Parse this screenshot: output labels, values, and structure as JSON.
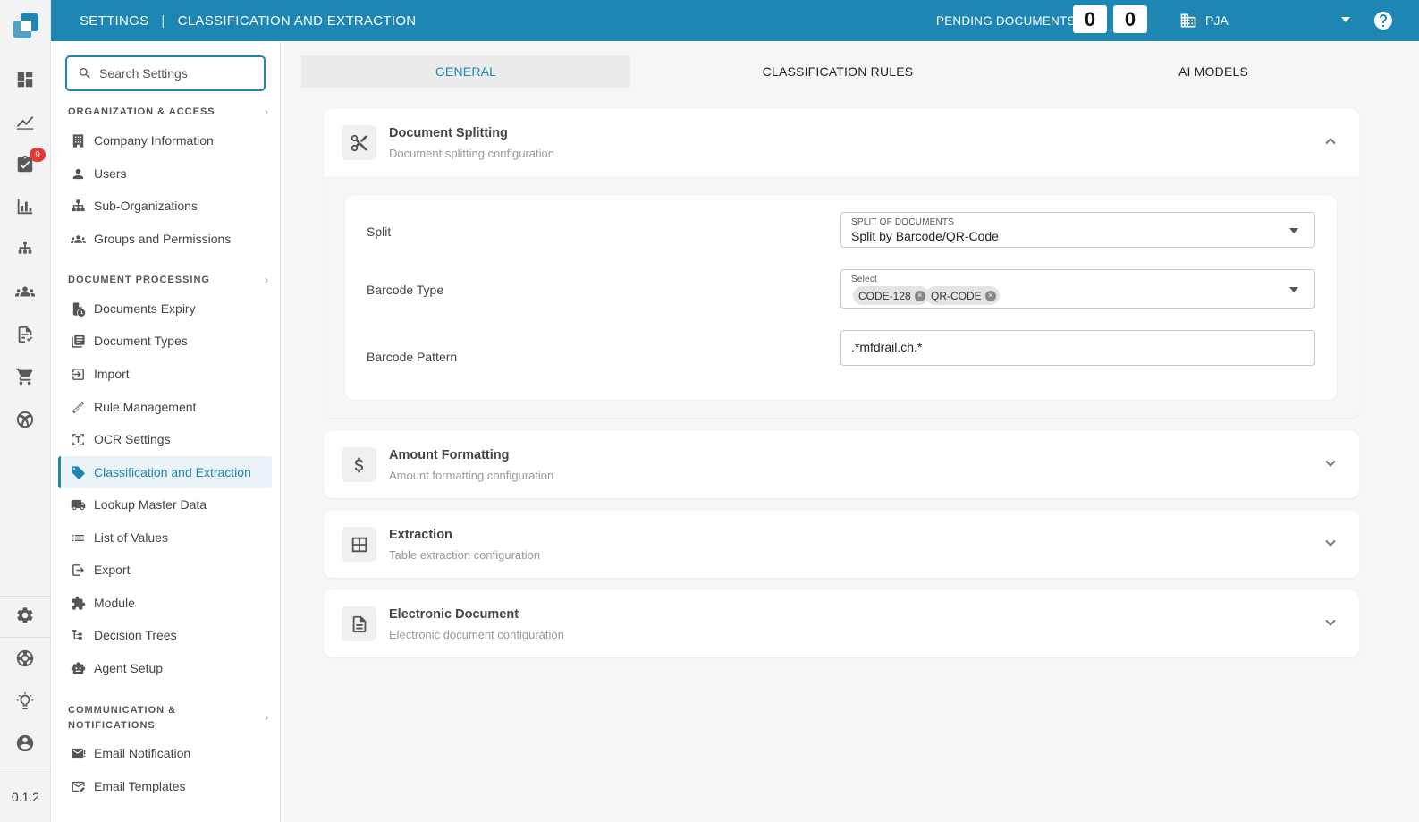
{
  "rail": {
    "badge_count": "9",
    "version": "0.1.2",
    "icons": [
      "dashboard-icon",
      "analytics-icon",
      "tasks-icon",
      "bar-chart-icon",
      "hierarchy-icon",
      "groups-icon",
      "document-check-icon",
      "cart-icon",
      "ai-logo-icon",
      "settings-icon",
      "support-icon",
      "lightbulb-icon",
      "account-icon"
    ]
  },
  "topbar": {
    "section": "SETTINGS",
    "separator": "|",
    "page": "CLASSIFICATION AND EXTRACTION",
    "pending_label": "PENDING DOCUMENTS:",
    "pending_counts": [
      "0",
      "0"
    ],
    "organization": "PJA",
    "accent_color": "#1e86b3"
  },
  "sidebar": {
    "search_placeholder": "Search Settings",
    "sections": [
      {
        "title": "ORGANIZATION & ACCESS",
        "items": [
          "Company Information",
          "Users",
          "Sub-Organizations",
          "Groups and Permissions"
        ]
      },
      {
        "title": "DOCUMENT PROCESSING",
        "items": [
          "Documents Expiry",
          "Document Types",
          "Import",
          "Rule Management",
          "OCR Settings",
          "Classification and Extraction",
          "Lookup Master Data",
          "List of Values",
          "Export",
          "Module",
          "Decision Trees",
          "Agent Setup"
        ]
      },
      {
        "title_line1": "COMMUNICATION &",
        "title_line2": "NOTIFICATIONS",
        "items": [
          "Email Notification",
          "Email Templates"
        ]
      }
    ],
    "active_item": "Classification and Extraction"
  },
  "tabs": [
    {
      "label": "GENERAL",
      "active": true
    },
    {
      "label": "CLASSIFICATION RULES",
      "active": false
    },
    {
      "label": "AI MODELS",
      "active": false
    }
  ],
  "panels": [
    {
      "title": "Document Splitting",
      "subtitle": "Document splitting configuration",
      "expanded": true,
      "fields": {
        "split": {
          "label": "Split",
          "small_label": "SPLIT OF DOCUMENTS",
          "value": "Split by Barcode/QR-Code"
        },
        "barcode_type": {
          "label": "Barcode Type",
          "small_label": "Select",
          "chips": [
            "CODE-128",
            "QR-CODE"
          ]
        },
        "barcode_pattern": {
          "label": "Barcode Pattern",
          "value": ".*mfdrail.ch.*"
        }
      }
    },
    {
      "title": "Amount Formatting",
      "subtitle": "Amount formatting configuration",
      "expanded": false
    },
    {
      "title": "Extraction",
      "subtitle": "Table extraction configuration",
      "expanded": false
    },
    {
      "title": "Electronic Document",
      "subtitle": "Electronic document configuration",
      "expanded": false
    }
  ]
}
